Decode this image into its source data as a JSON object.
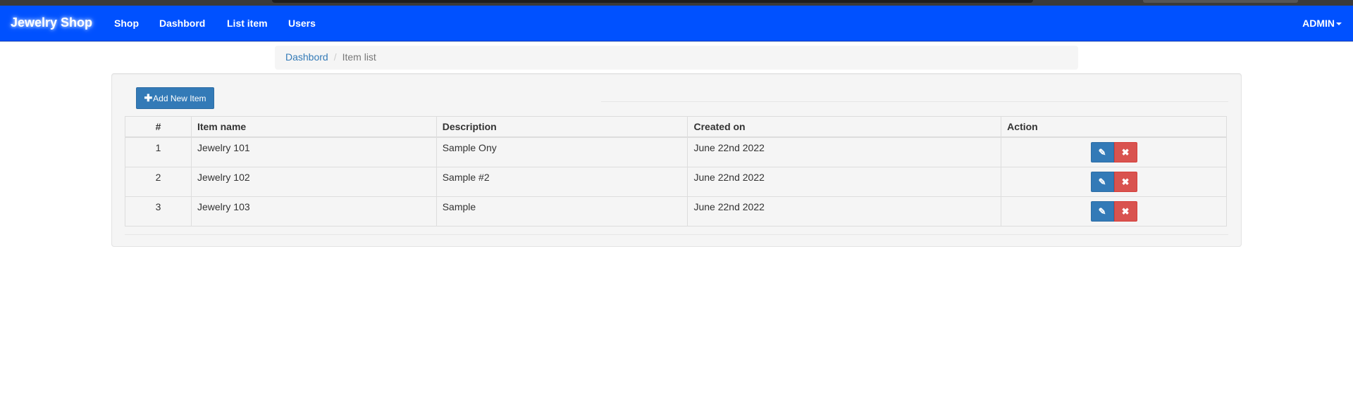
{
  "navbar": {
    "brand": "Jewelry Shop",
    "links": [
      "Shop",
      "Dashbord",
      "List item",
      "Users"
    ],
    "user_menu": "ADMIN"
  },
  "breadcrumb": {
    "items": [
      "Dashbord",
      "Item list"
    ]
  },
  "toolbar": {
    "add_label": "Add New Item",
    "add_icon": "plus-icon"
  },
  "table": {
    "headers": [
      "#",
      "Item name",
      "Description",
      "Created on",
      "Action"
    ],
    "rows": [
      {
        "num": "1",
        "name": "Jewelry 101",
        "description": "Sample Ony",
        "created": "June 22nd 2022"
      },
      {
        "num": "2",
        "name": "Jewelry 102",
        "description": "Sample #2",
        "created": "June 22nd 2022"
      },
      {
        "num": "3",
        "name": "Jewelry 103",
        "description": "Sample",
        "created": "June 22nd 2022"
      }
    ],
    "edit_icon": "pencil-icon",
    "delete_icon": "remove-icon"
  },
  "colors": {
    "navbar": "#0051ff",
    "primary": "#337ab7",
    "danger": "#d9534f",
    "well": "#f5f5f5"
  }
}
